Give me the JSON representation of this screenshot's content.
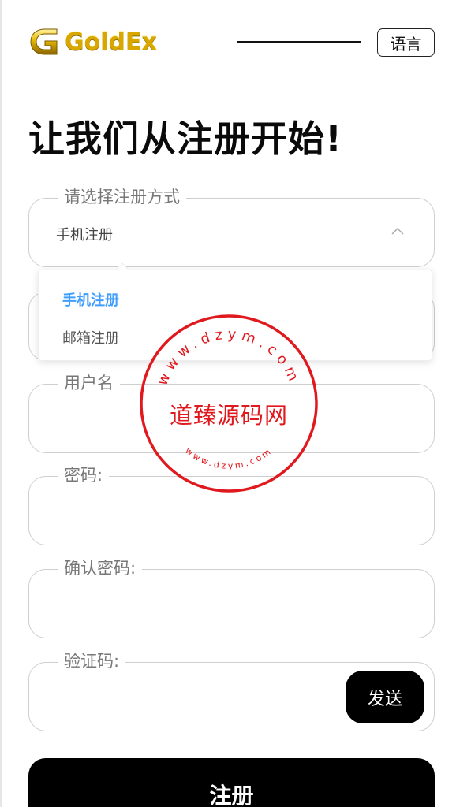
{
  "header": {
    "logo_text": "GoldEx",
    "language_button": "语言"
  },
  "page_title": "让我们从注册开始!",
  "form": {
    "method": {
      "label": "请选择注册方式",
      "value": "手机注册",
      "options": [
        "手机注册",
        "邮箱注册"
      ]
    },
    "username_label": "用户名",
    "password_label": "密码:",
    "confirm_password_label": "确认密码:",
    "verification_code_label": "验证码:",
    "send_button": "发送",
    "submit_button": "注册"
  },
  "watermark": {
    "text": "道臻源码网",
    "ring_text": "www.dzym.com"
  },
  "colors": {
    "accent_selected": "#409eff",
    "stamp_red": "#e0191f",
    "logo_gold": "#d9a800"
  }
}
